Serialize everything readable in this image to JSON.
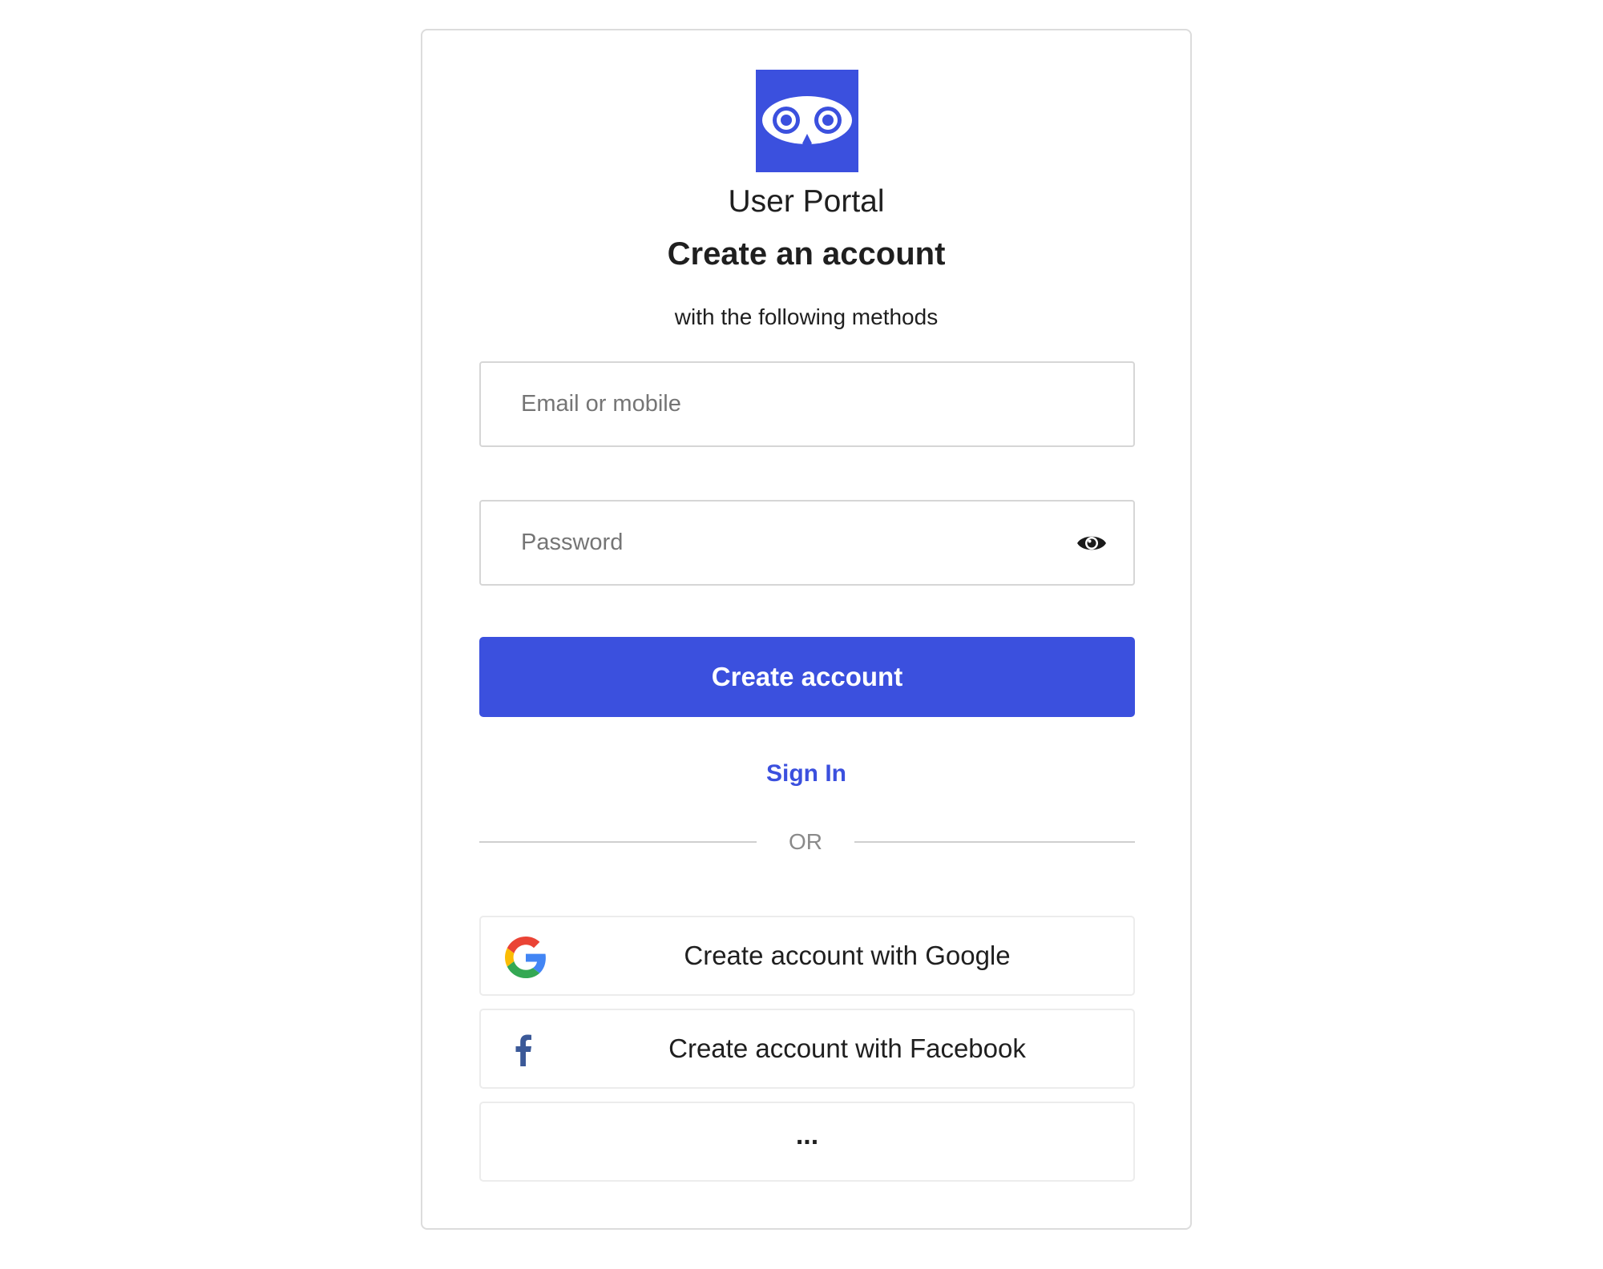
{
  "app": {
    "name": "User Portal",
    "logo_icon": "owl-eyes-logo-icon",
    "brand_color": "#3b50de"
  },
  "form": {
    "heading": "Create an account",
    "subheading": "with the following methods",
    "email": {
      "placeholder": "Email or mobile",
      "value": ""
    },
    "password": {
      "placeholder": "Password",
      "value": "",
      "toggle_icon": "eye-icon"
    },
    "submit_label": "Create account",
    "signin_label": "Sign In",
    "divider_label": "OR"
  },
  "social": {
    "google": {
      "label": "Create account with Google",
      "icon": "google-icon"
    },
    "facebook": {
      "label": "Create account with Facebook",
      "icon": "facebook-icon"
    },
    "more": {
      "label": "..."
    }
  }
}
